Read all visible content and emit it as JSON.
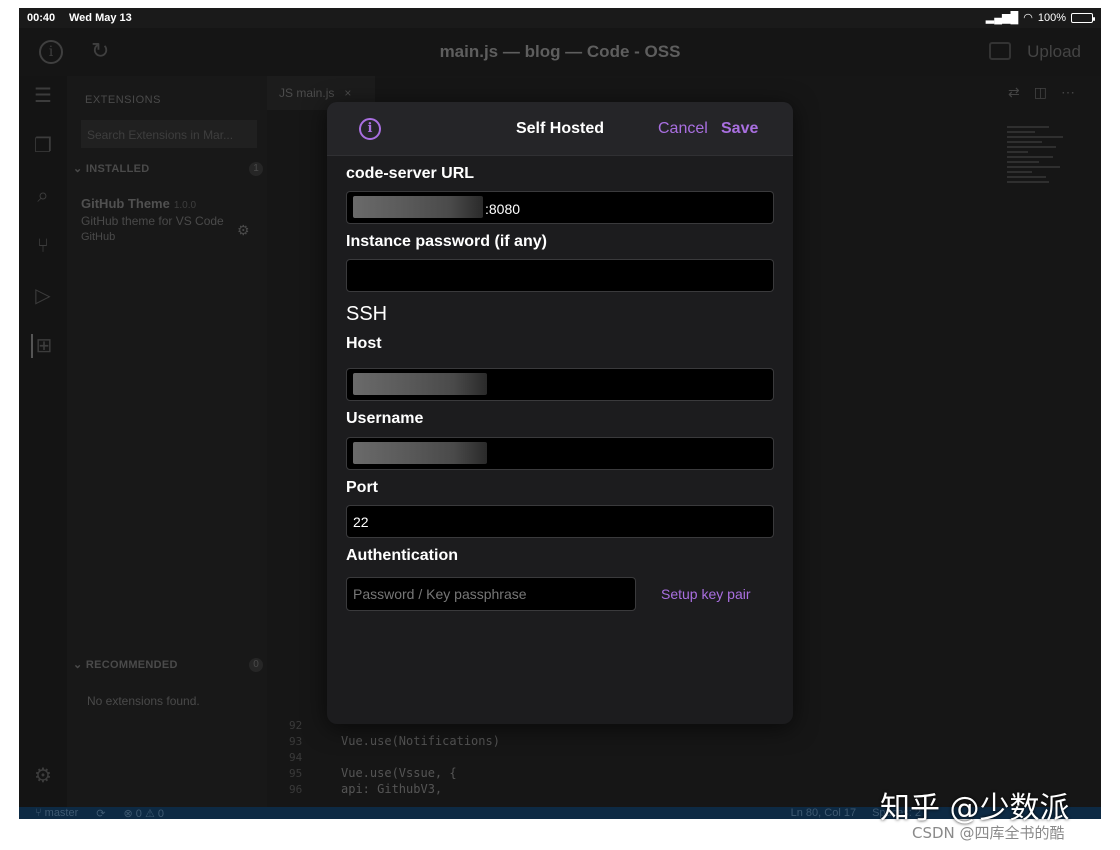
{
  "status": {
    "time": "00:40",
    "date": "Wed May 13",
    "battery": "100%"
  },
  "background": {
    "window_title": "main.js — blog — Code - OSS",
    "upload_label": "Upload",
    "sidebar": {
      "header": "EXTENSIONS",
      "search_placeholder": "Search Extensions in Mar...",
      "installed_label": "INSTALLED",
      "installed_count": "1",
      "extension_name": "GitHub Theme",
      "extension_version": "1.0.0",
      "extension_desc": "GitHub theme for VS Code",
      "extension_publisher": "GitHub",
      "recommended_label": "RECOMMENDED",
      "recommended_count": "0",
      "no_extensions": "No extensions found."
    },
    "editor": {
      "tab_label": "main.js",
      "code_lines": [
        "Vue.use(Notifications)",
        "Vue.use(Vssue, {",
        "  api: GithubV3,"
      ],
      "line_numbers": [
        "92",
        "93",
        "94",
        "95",
        "96"
      ]
    },
    "statusbar": {
      "branch": "master",
      "problems": "⊗ 0 ⚠ 0",
      "position": "Ln 80, Col 17",
      "spaces": "Spaces: 2"
    }
  },
  "modal": {
    "title": "Self Hosted",
    "cancel_label": "Cancel",
    "save_label": "Save",
    "url_label": "code-server URL",
    "url_suffix": ":8080",
    "password_label": "Instance password (if any)",
    "password_value": "",
    "ssh_section": "SSH",
    "host_label": "Host",
    "username_label": "Username",
    "port_label": "Port",
    "port_value": "22",
    "auth_label": "Authentication",
    "auth_placeholder": "Password / Key passphrase",
    "setup_key_label": "Setup key pair"
  },
  "watermark": "知乎 @少数派",
  "credit": "CSDN @四库全书的酷",
  "colors": {
    "accent": "#a96fe0",
    "modal_bg": "#1c1c1e",
    "field_bg": "#000000"
  }
}
